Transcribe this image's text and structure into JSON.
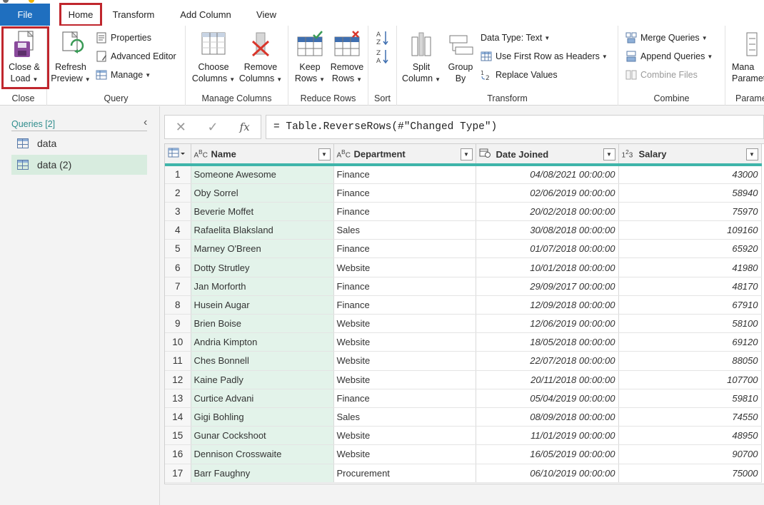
{
  "tabs": {
    "file": "File",
    "home": "Home",
    "transform": "Transform",
    "add_column": "Add Column",
    "view": "View"
  },
  "ribbon": {
    "close_group": {
      "label": "Close",
      "close_load_line1": "Close &",
      "close_load_line2": "Load"
    },
    "query_group": {
      "label": "Query",
      "refresh_line1": "Refresh",
      "refresh_line2": "Preview",
      "properties": "Properties",
      "advanced_editor": "Advanced Editor",
      "manage": "Manage"
    },
    "manage_columns_group": {
      "label": "Manage Columns",
      "choose_line1": "Choose",
      "choose_line2": "Columns",
      "remove_line1": "Remove",
      "remove_line2": "Columns"
    },
    "reduce_rows_group": {
      "label": "Reduce Rows",
      "keep_line1": "Keep",
      "keep_line2": "Rows",
      "remove_line1": "Remove",
      "remove_line2": "Rows"
    },
    "sort_group": {
      "label": "Sort"
    },
    "transform_group": {
      "label": "Transform",
      "split_line1": "Split",
      "split_line2": "Column",
      "group_line1": "Group",
      "group_line2": "By",
      "data_type": "Data Type: Text",
      "first_row_headers": "Use First Row as Headers",
      "replace_values": "Replace Values"
    },
    "combine_group": {
      "label": "Combine",
      "merge_queries": "Merge Queries",
      "append_queries": "Append Queries",
      "combine_files": "Combine Files"
    },
    "params_group": {
      "label": "Parame",
      "manage_line1": "Mana",
      "manage_line2": "Paramet"
    }
  },
  "queries": {
    "header": "Queries [2]",
    "items": [
      {
        "label": "data"
      },
      {
        "label": "data (2)"
      }
    ]
  },
  "formula": {
    "cancel": "✕",
    "commit": "✓",
    "fx": "fx",
    "text": "= Table.ReverseRows(#\"Changed Type\")"
  },
  "table": {
    "columns": [
      {
        "type_icon": "ABC",
        "name": "Name"
      },
      {
        "type_icon": "ABC",
        "name": "Department"
      },
      {
        "type_icon": "cal",
        "name": "Date Joined"
      },
      {
        "type_icon": "123",
        "name": "Salary"
      }
    ],
    "rows": [
      [
        "1",
        "Someone Awesome",
        "Finance",
        "04/08/2021 00:00:00",
        "43000"
      ],
      [
        "2",
        "Oby Sorrel",
        "Finance",
        "02/06/2019 00:00:00",
        "58940"
      ],
      [
        "3",
        "Beverie Moffet",
        "Finance",
        "20/02/2018 00:00:00",
        "75970"
      ],
      [
        "4",
        "Rafaelita Blaksland",
        "Sales",
        "30/08/2018 00:00:00",
        "109160"
      ],
      [
        "5",
        "Marney O'Breen",
        "Finance",
        "01/07/2018 00:00:00",
        "65920"
      ],
      [
        "6",
        "Dotty Strutley",
        "Website",
        "10/01/2018 00:00:00",
        "41980"
      ],
      [
        "7",
        "Jan Morforth",
        "Finance",
        "29/09/2017 00:00:00",
        "48170"
      ],
      [
        "8",
        "Husein Augar",
        "Finance",
        "12/09/2018 00:00:00",
        "67910"
      ],
      [
        "9",
        "Brien Boise",
        "Website",
        "12/06/2019 00:00:00",
        "58100"
      ],
      [
        "10",
        "Andria Kimpton",
        "Website",
        "18/05/2018 00:00:00",
        "69120"
      ],
      [
        "11",
        "Ches Bonnell",
        "Website",
        "22/07/2018 00:00:00",
        "88050"
      ],
      [
        "12",
        "Kaine Padly",
        "Website",
        "20/11/2018 00:00:00",
        "107700"
      ],
      [
        "13",
        "Curtice Advani",
        "Finance",
        "05/04/2019 00:00:00",
        "59810"
      ],
      [
        "14",
        "Gigi Bohling",
        "Sales",
        "08/09/2018 00:00:00",
        "74550"
      ],
      [
        "15",
        "Gunar Cockshoot",
        "Website",
        "11/01/2019 00:00:00",
        "48950"
      ],
      [
        "16",
        "Dennison Crosswaite",
        "Website",
        "16/05/2019 00:00:00",
        "90700"
      ],
      [
        "17",
        "Barr Faughny",
        "Procurement",
        "06/10/2019 00:00:00",
        "75000"
      ]
    ]
  },
  "colors": {
    "file_tab": "#1f6fbf",
    "highlight_box": "#c0262d",
    "header_accent": "#3fb5aa",
    "name_column_bg": "#e3f3ea"
  }
}
